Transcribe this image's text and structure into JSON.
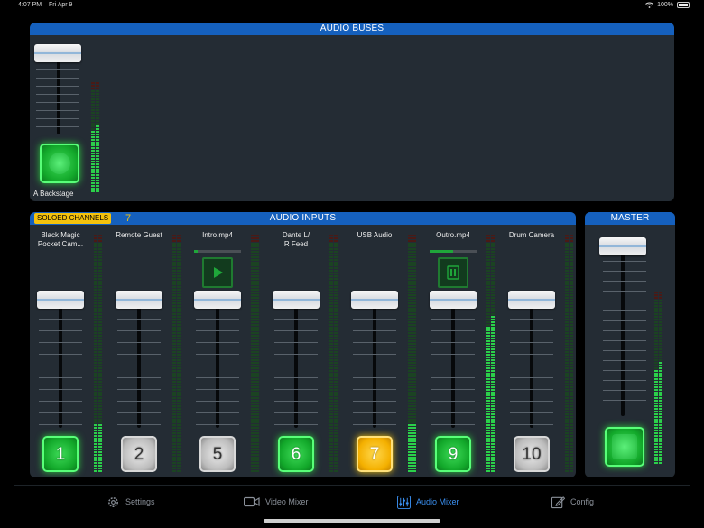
{
  "status": {
    "time": "4:07 PM",
    "date": "Fri Apr 9",
    "battery": "100%"
  },
  "buses": {
    "title": "AUDIO BUSES",
    "bus_name": "A Backstage",
    "meter_levels": [
      0.55,
      0.6
    ]
  },
  "inputs": {
    "title": "AUDIO INPUTS",
    "soloed_label": "SOLOED CHANNELS",
    "soloed_count": "7",
    "channels": [
      {
        "label": "Black Magic\nPocket Cam...",
        "number": "1",
        "state": "green",
        "meter": [
          0.2,
          0.2
        ],
        "media": "none"
      },
      {
        "label": "Remote Guest",
        "number": "2",
        "state": "gray",
        "meter": [
          0.0,
          0.0
        ],
        "media": "none"
      },
      {
        "label": "Intro.mp4",
        "number": "5",
        "state": "gray",
        "meter": [
          0.0,
          0.0
        ],
        "media": "play",
        "progress": 0.08
      },
      {
        "label": "Dante L/\nR Feed",
        "number": "6",
        "state": "green",
        "meter": [
          0.0,
          0.0
        ],
        "media": "none"
      },
      {
        "label": "USB Audio",
        "number": "7",
        "state": "gold",
        "meter": [
          0.2,
          0.2
        ],
        "media": "none"
      },
      {
        "label": "Outro.mp4",
        "number": "9",
        "state": "green",
        "meter": [
          0.61,
          0.66
        ],
        "media": "pause",
        "progress": 0.5
      },
      {
        "label": "Drum Camera",
        "number": "10",
        "state": "gray",
        "meter": [
          0.0,
          0.0
        ],
        "media": "none"
      }
    ]
  },
  "master": {
    "title": "MASTER",
    "meter_levels": [
      0.55,
      0.6
    ]
  },
  "tabs": [
    {
      "label": "Settings",
      "icon": "gear-icon",
      "active": false
    },
    {
      "label": "Video Mixer",
      "icon": "video-camera-icon",
      "active": false
    },
    {
      "label": "Audio Mixer",
      "icon": "sliders-icon",
      "active": true
    },
    {
      "label": "Config",
      "icon": "edit-icon",
      "active": false
    }
  ],
  "colors": {
    "accent": "#1560bd",
    "meter_green": "#2bd04a",
    "solo_gold": "#f4c20d",
    "tab_active": "#3a8ff0"
  }
}
